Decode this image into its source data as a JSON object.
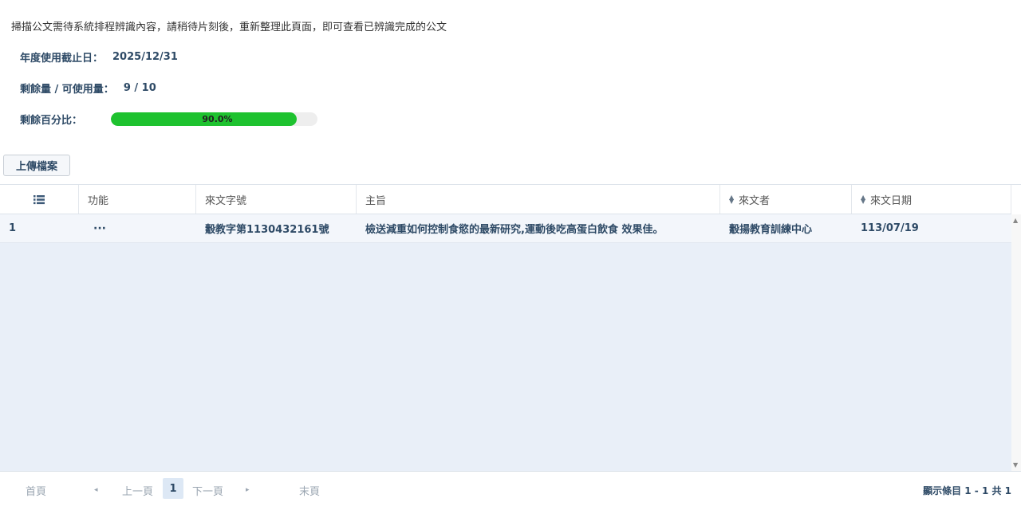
{
  "notice": "掃描公文需待系統排程辨識內容，請稍待片刻後，重新整理此頁面，即可查看已辨識完成的公文",
  "usage": {
    "deadline_label": "年度使用截止日：",
    "deadline_value": "2025/12/31",
    "quota_label": "剩餘量 / 可使用量：",
    "quota_value": "9 / 10",
    "percent_label": "剩餘百分比：",
    "percent_value": 0.9,
    "percent_text": "90.0%",
    "progress_color": "#1ec22f"
  },
  "upload_button": "上傳檔案",
  "table": {
    "columns": [
      {
        "key": "index",
        "label": "",
        "icon": "list-icon",
        "sortable": false
      },
      {
        "key": "actions",
        "label": "功能",
        "sortable": false
      },
      {
        "key": "doc_no",
        "label": "來文字號",
        "sortable": false
      },
      {
        "key": "subject",
        "label": "主旨",
        "sortable": false
      },
      {
        "key": "sender",
        "label": "來文者",
        "sortable": true
      },
      {
        "key": "date",
        "label": "來文日期",
        "sortable": true
      }
    ],
    "rows": [
      {
        "index": "1",
        "actions": "···",
        "doc_no": "觳教字第1130432161號",
        "subject": "檢送減重如何控制食慾的最新研究,運動後吃高蛋白飲食 效果佳。",
        "sender": "觳揚教育訓練中心",
        "date": "113/07/19"
      }
    ]
  },
  "pagination": {
    "first": "首頁",
    "prev_arrow": "◂",
    "prev": "上一頁",
    "current": "1",
    "next": "下一頁",
    "next_arrow": "▸",
    "last": "末頁",
    "summary": "顯示條目 1 - 1 共 1"
  },
  "colors": {
    "accent_text": "#2e4a66",
    "row_bg": "#f3f6fb",
    "body_bg": "#e9eff8"
  }
}
